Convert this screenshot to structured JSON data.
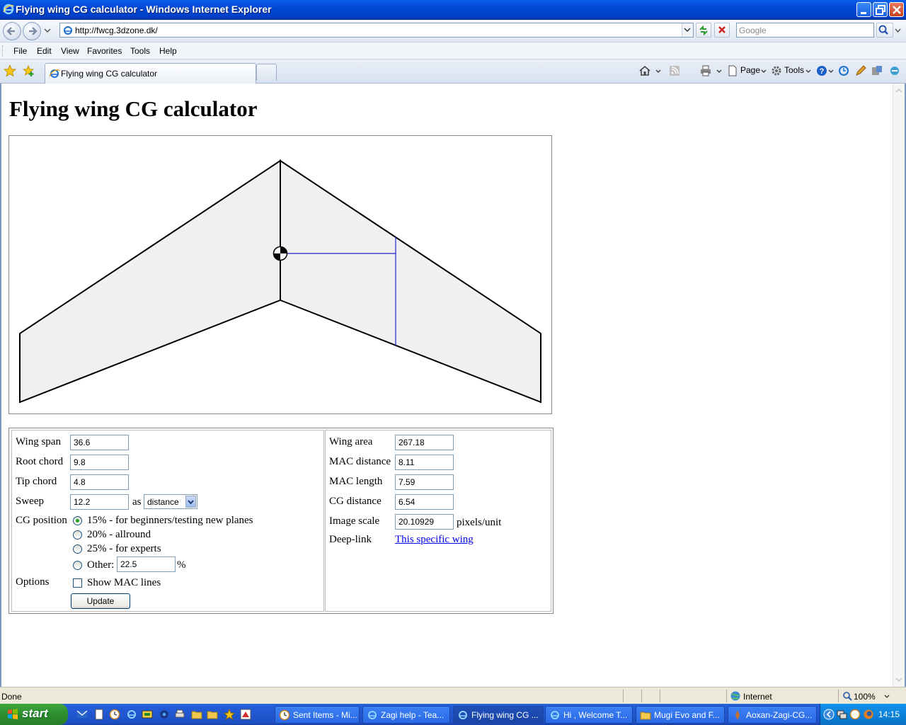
{
  "window": {
    "title": "Flying wing CG calculator - Windows Internet Explorer"
  },
  "address": {
    "url": "http://fwcg.3dzone.dk/",
    "search_placeholder": "Google"
  },
  "menu": [
    "File",
    "Edit",
    "View",
    "Favorites",
    "Tools",
    "Help"
  ],
  "tab": {
    "label": "Flying wing CG calculator"
  },
  "commandbar": {
    "page": "Page",
    "tools": "Tools"
  },
  "page": {
    "title": "Flying wing CG calculator",
    "inputs": {
      "wing_span": {
        "label": "Wing span",
        "value": "36.6"
      },
      "root_chord": {
        "label": "Root chord",
        "value": "9.8"
      },
      "tip_chord": {
        "label": "Tip chord",
        "value": "4.8"
      },
      "sweep": {
        "label": "Sweep",
        "value": "12.2",
        "as": "as",
        "mode": "distance"
      },
      "cg_position": {
        "label": "CG position",
        "options": [
          "15% - for beginners/testing new planes",
          "20% - allround",
          "25% - for experts",
          "Other:"
        ],
        "selected": 0,
        "other_value": "22.5",
        "percent": "%"
      },
      "options": {
        "label": "Options",
        "show_mac_lines": "Show MAC lines",
        "checked": false
      },
      "update_button": "Update"
    },
    "results": {
      "wing_area": {
        "label": "Wing area",
        "value": "267.18"
      },
      "mac_distance": {
        "label": "MAC distance",
        "value": "8.11"
      },
      "mac_length": {
        "label": "MAC length",
        "value": "7.59"
      },
      "cg_distance": {
        "label": "CG distance",
        "value": "6.54"
      },
      "image_scale": {
        "label": "Image scale",
        "value": "20.10929",
        "unit": "pixels/unit"
      },
      "deep_link": {
        "label": "Deep-link",
        "text": "This specific wing"
      }
    }
  },
  "statusbar": {
    "text": "Done",
    "zone": "Internet",
    "zoom": "100%"
  },
  "taskbar": {
    "start": "start",
    "tasks": [
      {
        "label": "Sent Items - Mi...",
        "icon": "outlook-icon"
      },
      {
        "label": "Zagi help - Tea...",
        "icon": "ie-icon"
      },
      {
        "label": "Flying wing CG ...",
        "icon": "ie-icon",
        "active": true
      },
      {
        "label": "Hi , Welcome T...",
        "icon": "ie-icon"
      },
      {
        "label": "Mugi Evo and F...",
        "icon": "folder-icon"
      },
      {
        "label": "Aoxan-Zagi-CG...",
        "icon": "image-icon"
      }
    ],
    "clock": "14:15"
  },
  "colors": {
    "wing_fill": "#f0f0f0",
    "mac_line": "#2020c8",
    "link": "#0000ee",
    "title_bar": "#0046D5"
  }
}
